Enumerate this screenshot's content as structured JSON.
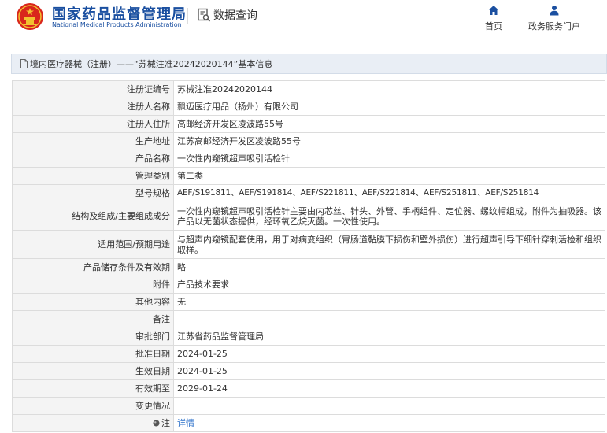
{
  "header": {
    "brand_cn": "国家药品监督管理局",
    "brand_en": "National Medical Products Administration",
    "query_label": "数据查询",
    "nav_home": "首页",
    "nav_portal": "政务服务门户"
  },
  "title": {
    "text": "境内医疗器械（注册）——“苏械注准20242020144”基本信息"
  },
  "rows": [
    {
      "label": "注册证编号",
      "value": "苏械注准20242020144"
    },
    {
      "label": "注册人名称",
      "value": "飘迈医疗用品（扬州）有限公司"
    },
    {
      "label": "注册人住所",
      "value": "高邮经济开发区凌波路55号"
    },
    {
      "label": "生产地址",
      "value": "江苏高邮经济开发区凌波路55号"
    },
    {
      "label": "产品名称",
      "value": "一次性内窥镜超声吸引活检针"
    },
    {
      "label": "管理类别",
      "value": "第二类"
    },
    {
      "label": "型号规格",
      "value": "AEF/S191811、AEF/S191814、AEF/S221811、AEF/S221814、AEF/S251811、AEF/S251814"
    },
    {
      "label": "结构及组成/主要组成成分",
      "value": "一次性内窥镜超声吸引活检针主要由内芯丝、针头、外管、手柄组件、定位器、螺纹帽组成，附件为抽吸器。该产品以无菌状态提供，经环氧乙烷灭菌。一次性使用。"
    },
    {
      "label": "适用范围/预期用途",
      "value": "与超声内窥镜配套使用，用于对病变组织（胃肠道黏膜下损伤和壁外损伤）进行超声引导下细针穿刺活检和组织取样。"
    },
    {
      "label": "产品储存条件及有效期",
      "value": "略"
    },
    {
      "label": "附件",
      "value": "产品技术要求"
    },
    {
      "label": "其他内容",
      "value": "无"
    },
    {
      "label": "备注",
      "value": ""
    },
    {
      "label": "审批部门",
      "value": "江苏省药品监督管理局"
    },
    {
      "label": "批准日期",
      "value": "2024-01-25"
    },
    {
      "label": "生效日期",
      "value": "2024-01-25"
    },
    {
      "label": "有效期至",
      "value": "2029-01-24"
    },
    {
      "label": "变更情况",
      "value": ""
    },
    {
      "label": "注",
      "value": "详情"
    }
  ],
  "colors": {
    "brand_blue": "#1a4fa0",
    "link_blue": "#2a6fc9",
    "emblem_red": "#d9261c",
    "emblem_gold": "#f2c230"
  },
  "icons": {
    "emblem": "national-emblem",
    "query": "document-search-icon",
    "home": "home-icon",
    "portal": "user-icon",
    "title": "document-icon",
    "note": "info-dot-icon"
  }
}
